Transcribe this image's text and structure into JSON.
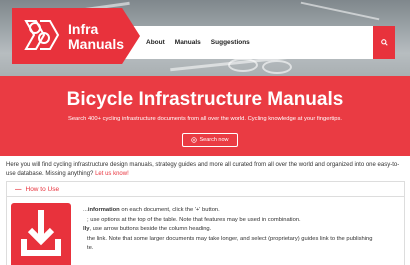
{
  "brand": {
    "name_line1": "Infra",
    "name_line2": "Manuals",
    "accent": "#e8323c"
  },
  "nav": {
    "items": [
      {
        "label": "About"
      },
      {
        "label": "Manuals"
      },
      {
        "label": "Suggestions"
      }
    ],
    "search_icon": "search-icon"
  },
  "hero": {
    "title": "Bicycle Infrastructure Manuals",
    "subtitle": "Search 400+ cycling infrastructure documents from all over the world. Cycling knowledge at your fingertips.",
    "button_label": "Search now",
    "button_icon": "plus-circle-icon"
  },
  "intro": {
    "text": "Here you will find cycling infrastructure design manuals, strategy guides and more all curated from all over the world and organized into one easy-to-use database. Missing anything?",
    "link": "Let us know!"
  },
  "how_to_use": {
    "toggle": "—",
    "title": "How to Use",
    "lines": [
      {
        "lead": "...",
        "bold": "information",
        "rest": " on each document, click the '+' button."
      },
      {
        "lead": "",
        "bold": "",
        "rest": "; use options at the top of the table. Note that features may be used in combination."
      },
      {
        "lead": "",
        "bold": "lly",
        "rest": ", use arrow buttons beside the column heading."
      },
      {
        "lead": "",
        "bold": "",
        "rest": "the link. Note that some larger documents may take longer, and select (proprietary) guides link to the publishing"
      },
      {
        "lead": "",
        "bold": "",
        "rest": "te."
      }
    ]
  },
  "overlay": {
    "icon": "download-icon"
  }
}
